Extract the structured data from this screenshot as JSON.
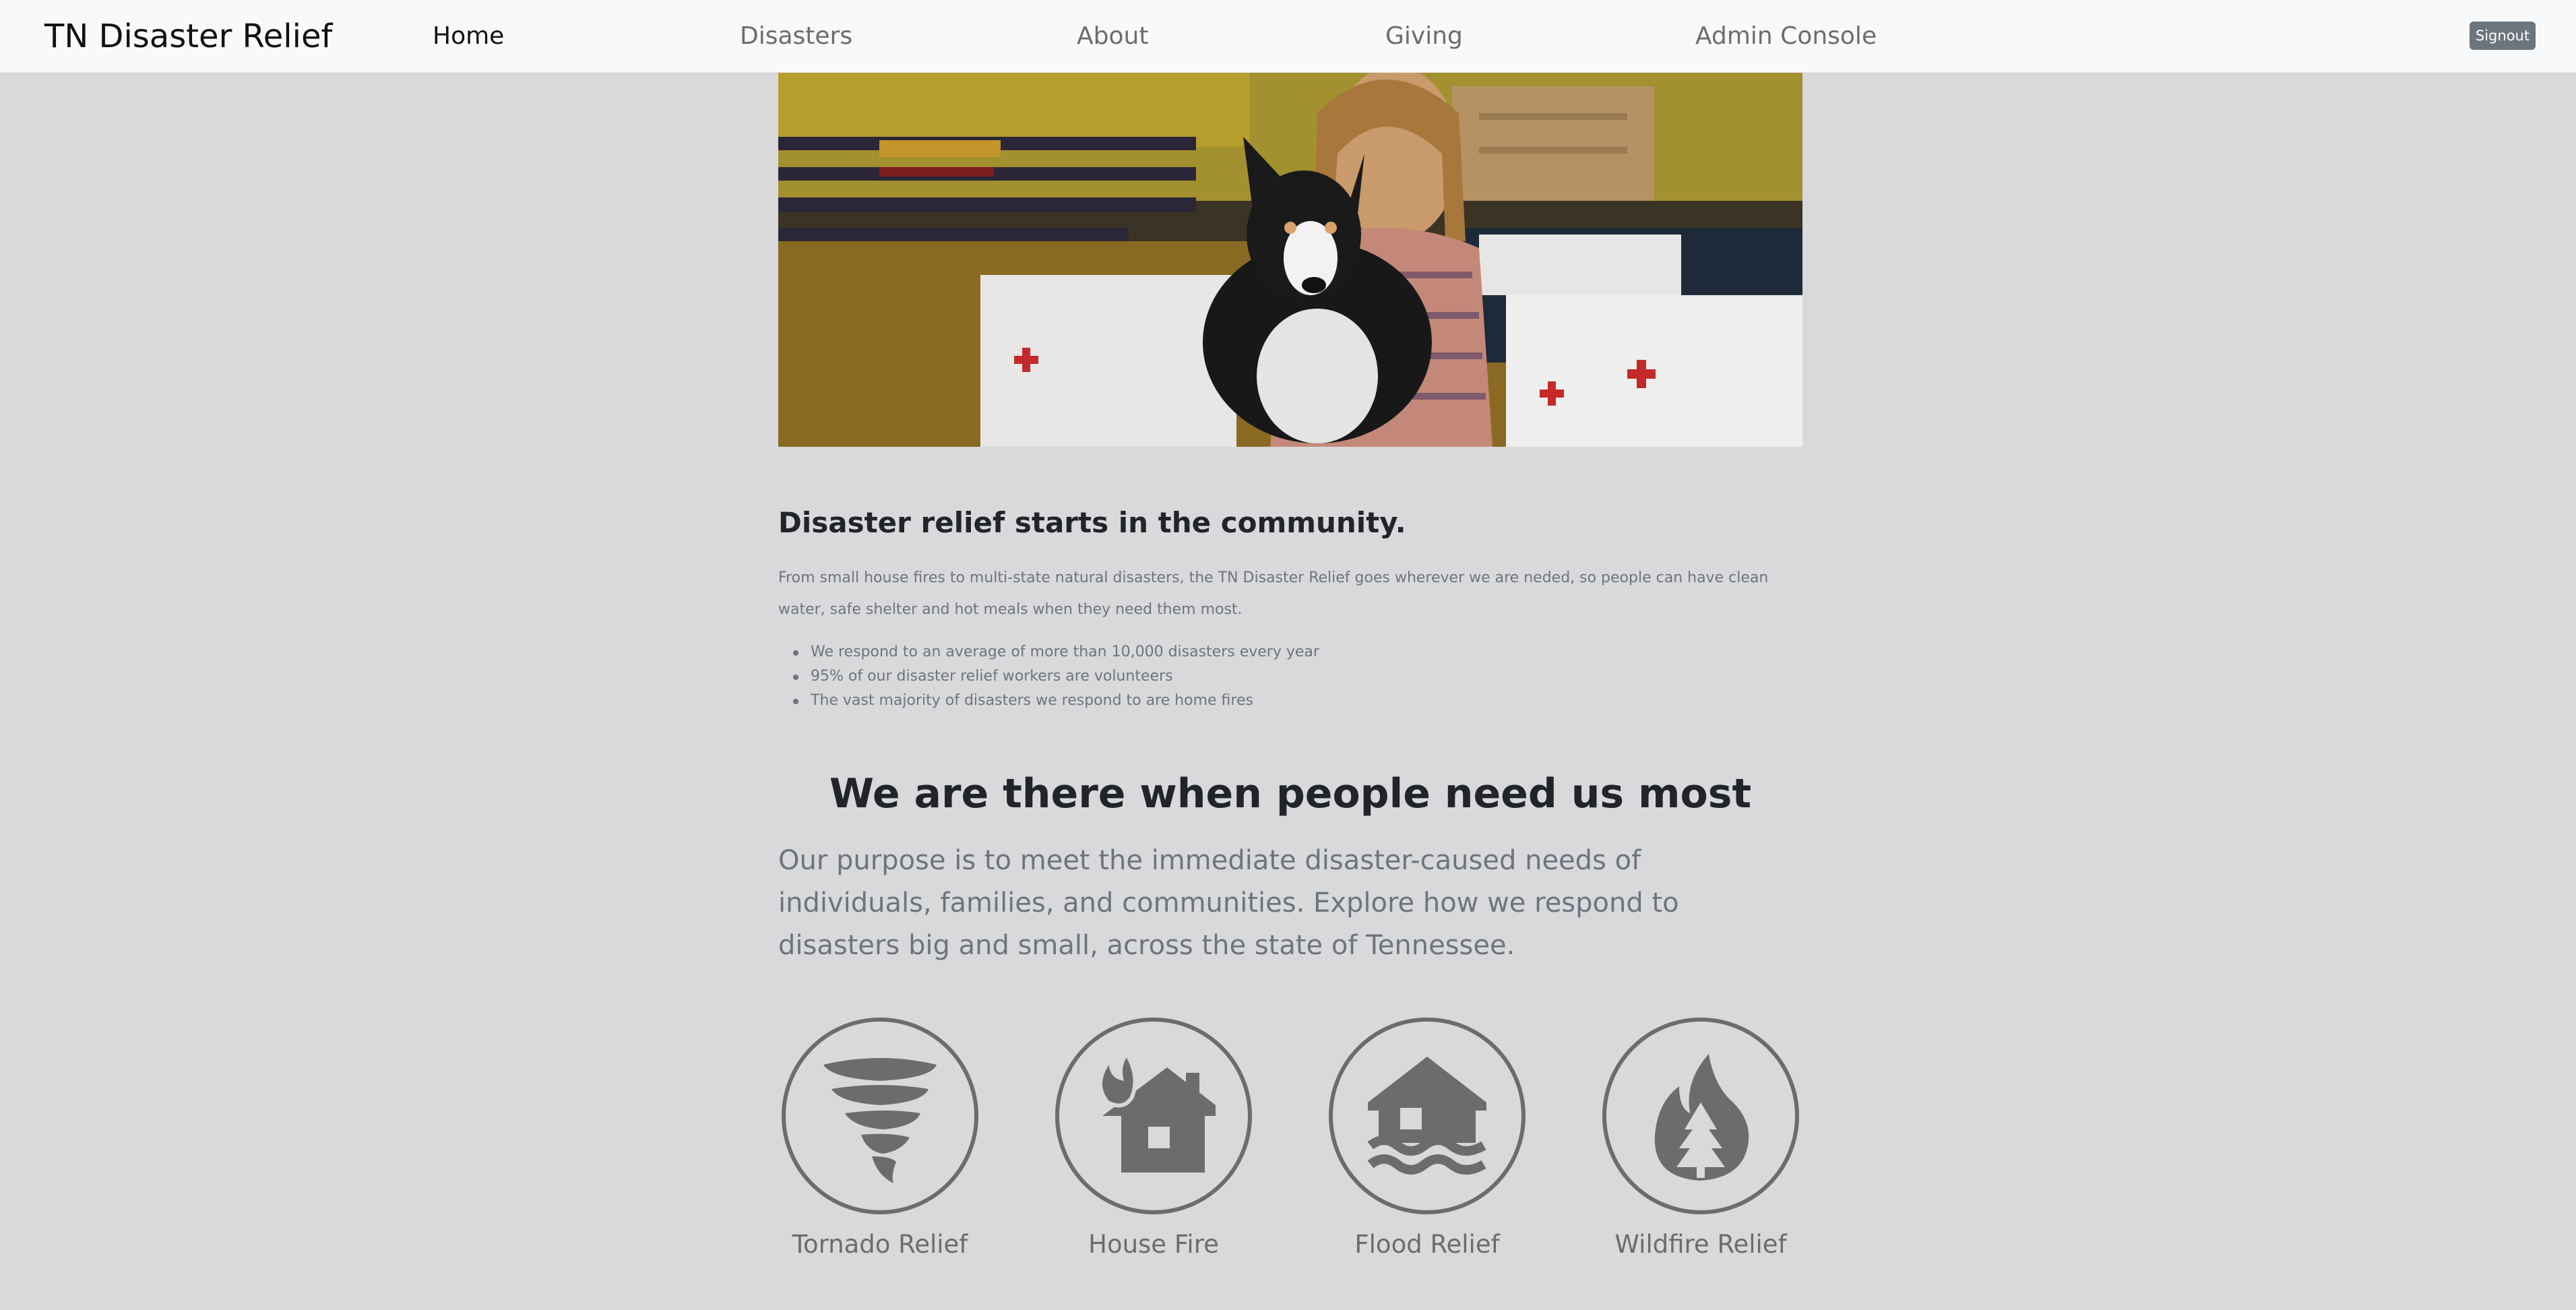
{
  "navbar": {
    "brand": "TN Disaster Relief",
    "links": [
      {
        "label": "Home",
        "active": true
      },
      {
        "label": "Disasters",
        "active": false
      },
      {
        "label": "About",
        "active": false
      },
      {
        "label": "Giving",
        "active": false
      },
      {
        "label": "Admin Console",
        "active": false
      }
    ],
    "signout_label": "Signout"
  },
  "section_community": {
    "heading": "Disaster relief starts in the community.",
    "intro": "From small house fires to multi-state natural disasters, the TN Disaster Relief goes wherever we are neded, so people can have clean water, safe shelter and hot meals when they need them most.",
    "facts": [
      "We respond to an average of more than 10,000 disasters every year",
      "95% of our disaster relief workers are volunteers",
      "The vast majority of disasters we respond to are home fires"
    ]
  },
  "section_mission": {
    "heading": "We are there when people need us most",
    "lead": "Our purpose is to meet the immediate disaster-caused needs of individuals, families, and communities. Explore how we respond to disasters big and small, across the state of Tennessee."
  },
  "relief_types": [
    {
      "label": "Tornado Relief",
      "icon": "tornado-icon"
    },
    {
      "label": "House Fire",
      "icon": "house-fire-icon"
    },
    {
      "label": "Flood Relief",
      "icon": "flood-icon"
    },
    {
      "label": "Wildfire Relief",
      "icon": "wildfire-icon"
    }
  ],
  "colors": {
    "page_background": "#d9d9db",
    "navbar_background": "#f8f9fa",
    "icon_gray": "#6c6c6c",
    "signout_button": "#6c757d"
  }
}
